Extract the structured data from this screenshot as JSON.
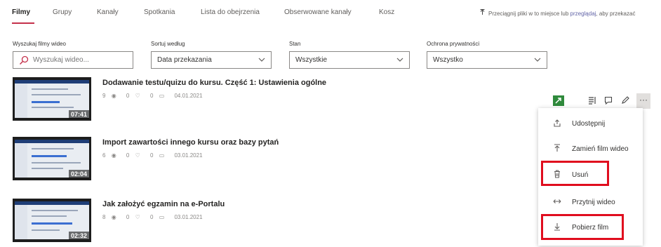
{
  "tabs": [
    {
      "label": "Filmy",
      "active": true
    },
    {
      "label": "Grupy",
      "active": false
    },
    {
      "label": "Kanały",
      "active": false
    },
    {
      "label": "Spotkania",
      "active": false
    },
    {
      "label": "Lista do obejrzenia",
      "active": false
    },
    {
      "label": "Obserwowane kanały",
      "active": false
    },
    {
      "label": "Kosz",
      "active": false
    }
  ],
  "upload_hint": {
    "icon": "upload-arrow-icon",
    "text_before": "Przeciągnij pliki w to miejsce lub ",
    "link": "przeglądaj",
    "text_after": ", aby przekazać"
  },
  "filters": {
    "search": {
      "label": "Wyszukaj filmy wideo",
      "placeholder": "Wyszukaj wideo..."
    },
    "sort": {
      "label": "Sortuj według",
      "value": "Data przekazania"
    },
    "state": {
      "label": "Stan",
      "value": "Wszystkie"
    },
    "privacy": {
      "label": "Ochrona prywatności",
      "value": "Wszystko"
    }
  },
  "videos": [
    {
      "title": "Dodawanie testu/quizu do kursu. Część 1: Ustawienia ogólne",
      "views": "9",
      "likes": "0",
      "comments": "0",
      "date": "04.01.2021",
      "duration": "07:41"
    },
    {
      "title": "Import zawartości innego kursu oraz bazy pytań",
      "views": "6",
      "likes": "0",
      "comments": "0",
      "date": "03.01.2021",
      "duration": "02:04"
    },
    {
      "title": "Jak założyć egzamin na e-Portalu",
      "views": "8",
      "likes": "0",
      "comments": "0",
      "date": "03.01.2021",
      "duration": "02:32"
    }
  ],
  "menu": {
    "items": [
      {
        "label": "Udostępnij",
        "icon": "share-icon"
      },
      {
        "label": "Zamień film wideo",
        "icon": "replace-upload-icon"
      },
      {
        "label": "Usuń",
        "icon": "trash-icon",
        "highlighted": true
      },
      {
        "label": "Przytnij wideo",
        "icon": "trim-icon"
      },
      {
        "label": "Pobierz film",
        "icon": "download-icon",
        "highlighted": true
      }
    ]
  },
  "colors": {
    "accent": "#c4314b",
    "highlight": "#e00d1e",
    "link": "#6264a7"
  }
}
